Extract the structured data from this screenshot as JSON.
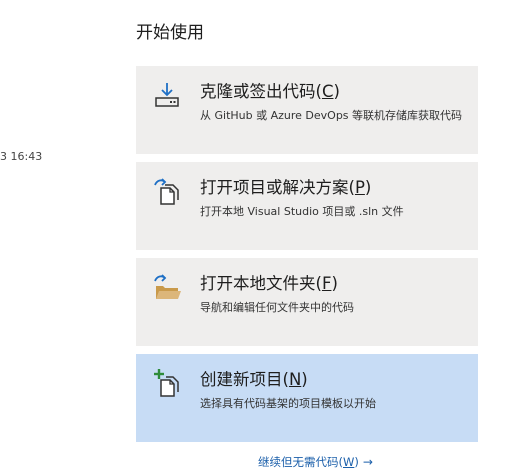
{
  "left_panel": {
    "timestamp": "3 16:43"
  },
  "start": {
    "title": "开始使用",
    "actions": [
      {
        "title_prefix": "克隆或签出代码(",
        "accel": "C",
        "title_suffix": ")",
        "desc": "从 GitHub 或 Azure DevOps 等联机存储库获取代码",
        "icon": "clone-download-icon"
      },
      {
        "title_prefix": "打开项目或解决方案(",
        "accel": "P",
        "title_suffix": ")",
        "desc": "打开本地 Visual Studio 项目或 .sln 文件",
        "icon": "open-project-icon"
      },
      {
        "title_prefix": "打开本地文件夹(",
        "accel": "F",
        "title_suffix": ")",
        "desc": "导航和编辑任何文件夹中的代码",
        "icon": "open-folder-icon"
      },
      {
        "title_prefix": "创建新项目(",
        "accel": "N",
        "title_suffix": ")",
        "desc": "选择具有代码基架的项目模板以开始",
        "icon": "new-project-icon"
      }
    ],
    "continue_link": {
      "prefix": "继续但无需代码(",
      "accel": "W",
      "suffix": ")",
      "arrow": "→"
    }
  },
  "colors": {
    "card_bg": "#efeeed",
    "card_active_bg": "#c7dcf5",
    "link": "#1b5faa",
    "accent_blue": "#1e6fc5",
    "accent_green": "#2e8b3a",
    "folder": "#dcb67a"
  }
}
